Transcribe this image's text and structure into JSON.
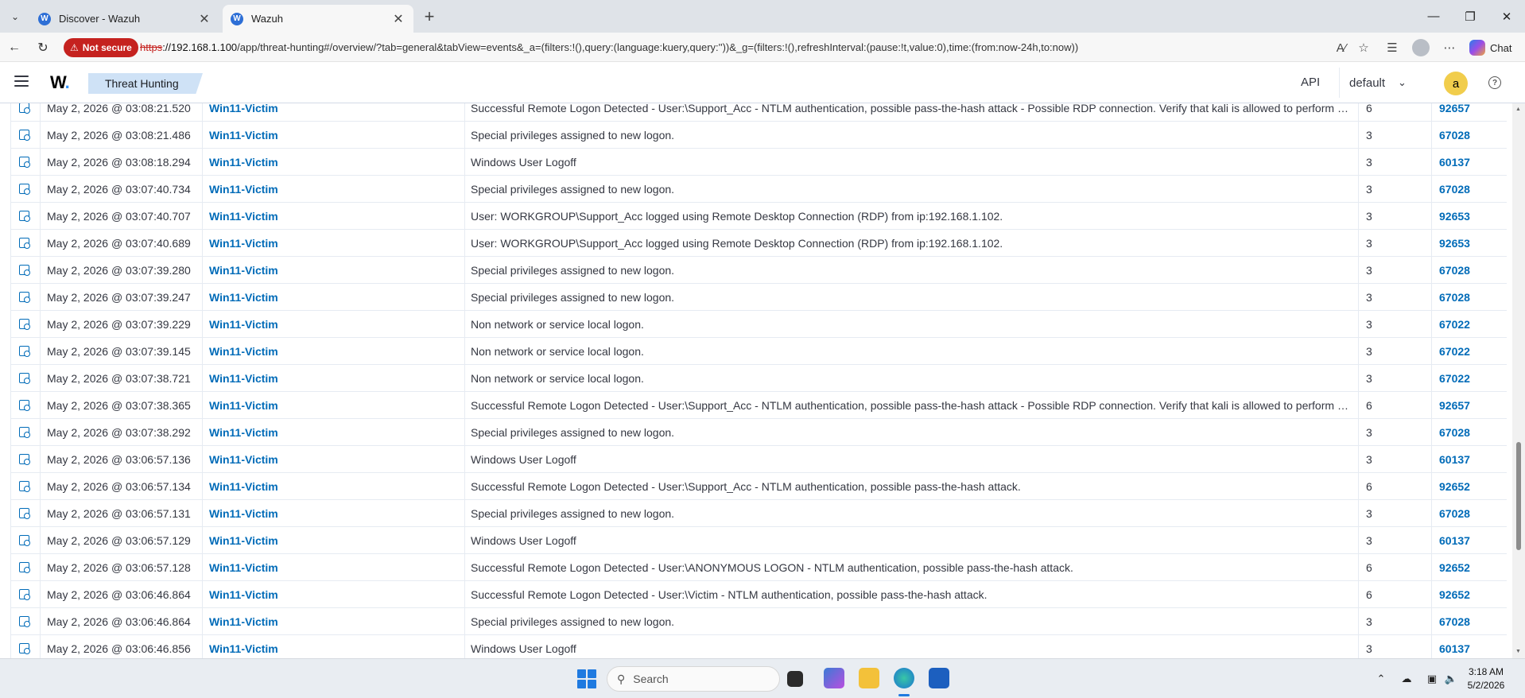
{
  "browser": {
    "tabs": [
      {
        "title": "Discover - Wazuh",
        "active": false
      },
      {
        "title": "Wazuh",
        "active": true
      }
    ],
    "security_label": "Not secure",
    "url_scheme": "https",
    "url_host": "://192.168.1.100",
    "url_path": "/app/threat-hunting#/overview/?tab=general&tabView=events&_a=(filters:!(),query:(language:kuery,query:''))&_g=(filters:!(),refreshInterval:(pause:!t,value:0),time:(from:now-24h,to:now))",
    "chat_label": "Chat"
  },
  "app": {
    "logo": "W",
    "logo_dot": ".",
    "breadcrumb": "Threat Hunting",
    "api_label": "API",
    "environment": "default",
    "avatar_letter": "a"
  },
  "events": [
    {
      "time": "May 2, 2026 @ 03:08:21.520",
      "agent": "Win11-Victim",
      "description": "Successful Remote Logon Detected - User:\\Support_Acc - NTLM authentication, possible pass-the-hash attack - Possible RDP connection. Verify that kali is allowed to perform RDP connections",
      "level": "6",
      "rule_id": "92657"
    },
    {
      "time": "May 2, 2026 @ 03:08:21.486",
      "agent": "Win11-Victim",
      "description": "Special privileges assigned to new logon.",
      "level": "3",
      "rule_id": "67028"
    },
    {
      "time": "May 2, 2026 @ 03:08:18.294",
      "agent": "Win11-Victim",
      "description": "Windows User Logoff",
      "level": "3",
      "rule_id": "60137"
    },
    {
      "time": "May 2, 2026 @ 03:07:40.734",
      "agent": "Win11-Victim",
      "description": "Special privileges assigned to new logon.",
      "level": "3",
      "rule_id": "67028"
    },
    {
      "time": "May 2, 2026 @ 03:07:40.707",
      "agent": "Win11-Victim",
      "description": "User: WORKGROUP\\Support_Acc logged using Remote Desktop Connection (RDP) from ip:192.168.1.102.",
      "level": "3",
      "rule_id": "92653"
    },
    {
      "time": "May 2, 2026 @ 03:07:40.689",
      "agent": "Win11-Victim",
      "description": "User: WORKGROUP\\Support_Acc logged using Remote Desktop Connection (RDP) from ip:192.168.1.102.",
      "level": "3",
      "rule_id": "92653"
    },
    {
      "time": "May 2, 2026 @ 03:07:39.280",
      "agent": "Win11-Victim",
      "description": "Special privileges assigned to new logon.",
      "level": "3",
      "rule_id": "67028"
    },
    {
      "time": "May 2, 2026 @ 03:07:39.247",
      "agent": "Win11-Victim",
      "description": "Special privileges assigned to new logon.",
      "level": "3",
      "rule_id": "67028"
    },
    {
      "time": "May 2, 2026 @ 03:07:39.229",
      "agent": "Win11-Victim",
      "description": "Non network or service local logon.",
      "level": "3",
      "rule_id": "67022"
    },
    {
      "time": "May 2, 2026 @ 03:07:39.145",
      "agent": "Win11-Victim",
      "description": "Non network or service local logon.",
      "level": "3",
      "rule_id": "67022"
    },
    {
      "time": "May 2, 2026 @ 03:07:38.721",
      "agent": "Win11-Victim",
      "description": "Non network or service local logon.",
      "level": "3",
      "rule_id": "67022"
    },
    {
      "time": "May 2, 2026 @ 03:07:38.365",
      "agent": "Win11-Victim",
      "description": "Successful Remote Logon Detected - User:\\Support_Acc - NTLM authentication, possible pass-the-hash attack - Possible RDP connection. Verify that kali is allowed to perform RDP connections",
      "level": "6",
      "rule_id": "92657"
    },
    {
      "time": "May 2, 2026 @ 03:07:38.292",
      "agent": "Win11-Victim",
      "description": "Special privileges assigned to new logon.",
      "level": "3",
      "rule_id": "67028"
    },
    {
      "time": "May 2, 2026 @ 03:06:57.136",
      "agent": "Win11-Victim",
      "description": "Windows User Logoff",
      "level": "3",
      "rule_id": "60137"
    },
    {
      "time": "May 2, 2026 @ 03:06:57.134",
      "agent": "Win11-Victim",
      "description": "Successful Remote Logon Detected - User:\\Support_Acc - NTLM authentication, possible pass-the-hash attack.",
      "level": "6",
      "rule_id": "92652"
    },
    {
      "time": "May 2, 2026 @ 03:06:57.131",
      "agent": "Win11-Victim",
      "description": "Special privileges assigned to new logon.",
      "level": "3",
      "rule_id": "67028"
    },
    {
      "time": "May 2, 2026 @ 03:06:57.129",
      "agent": "Win11-Victim",
      "description": "Windows User Logoff",
      "level": "3",
      "rule_id": "60137"
    },
    {
      "time": "May 2, 2026 @ 03:06:57.128",
      "agent": "Win11-Victim",
      "description": "Successful Remote Logon Detected - User:\\ANONYMOUS LOGON - NTLM authentication, possible pass-the-hash attack.",
      "level": "6",
      "rule_id": "92652"
    },
    {
      "time": "May 2, 2026 @ 03:06:46.864",
      "agent": "Win11-Victim",
      "description": "Successful Remote Logon Detected - User:\\Victim - NTLM authentication, possible pass-the-hash attack.",
      "level": "6",
      "rule_id": "92652"
    },
    {
      "time": "May 2, 2026 @ 03:06:46.864",
      "agent": "Win11-Victim",
      "description": "Special privileges assigned to new logon.",
      "level": "3",
      "rule_id": "67028"
    },
    {
      "time": "May 2, 2026 @ 03:06:46.856",
      "agent": "Win11-Victim",
      "description": "Windows User Logoff",
      "level": "3",
      "rule_id": "60137"
    }
  ],
  "taskbar": {
    "search_placeholder": "Search",
    "time": "3:18 AM",
    "date": "5/2/2026"
  },
  "colors": {
    "link": "#006bb8",
    "breadcrumb_bg": "#cfe2f6",
    "not_secure": "#c5221f"
  }
}
